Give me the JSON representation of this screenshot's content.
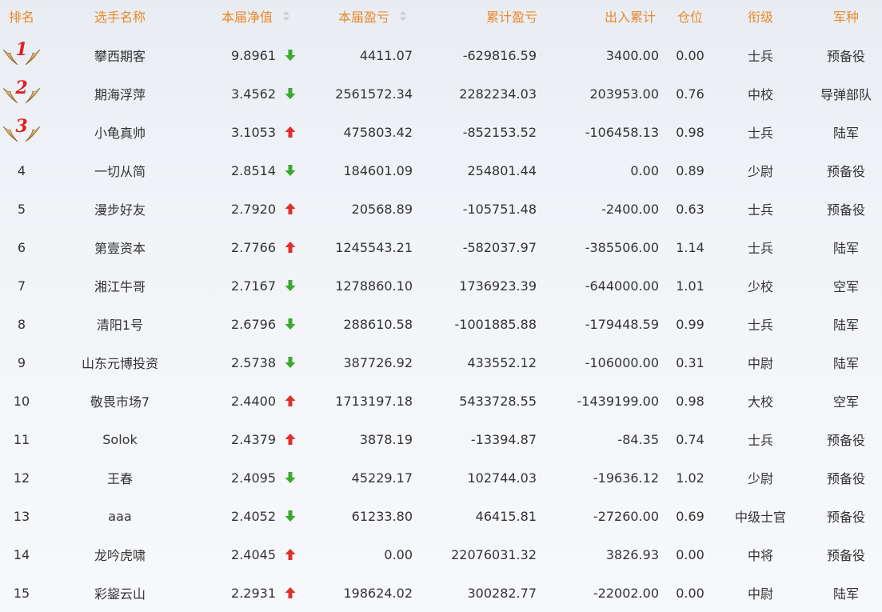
{
  "columns": [
    {
      "key": "rank",
      "label": "排名",
      "sortable": false
    },
    {
      "key": "name",
      "label": "选手名称",
      "sortable": false
    },
    {
      "key": "nav",
      "label": "本届净值",
      "sortable": true
    },
    {
      "key": "profit",
      "label": "本届盈亏",
      "sortable": true
    },
    {
      "key": "cum_profit",
      "label": "累计盈亏",
      "sortable": false
    },
    {
      "key": "inout",
      "label": "出入累计",
      "sortable": false
    },
    {
      "key": "position",
      "label": "仓位",
      "sortable": false
    },
    {
      "key": "grade",
      "label": "衔级",
      "sortable": false
    },
    {
      "key": "branch",
      "label": "军种",
      "sortable": false
    }
  ],
  "colors": {
    "header": "#e98a2c",
    "up": "#e0302c",
    "down": "#3aaa2e",
    "rank_badge": "#e02020"
  },
  "rows": [
    {
      "rank": "1",
      "badge": true,
      "name": "攀西期客",
      "nav": "9.8961",
      "trend": "down",
      "profit": "4411.07",
      "cum_profit": "-629816.59",
      "inout": "3400.00",
      "position": "0.00",
      "grade": "士兵",
      "branch": "预备役"
    },
    {
      "rank": "2",
      "badge": true,
      "name": "期海浮萍",
      "nav": "3.4562",
      "trend": "down",
      "profit": "2561572.34",
      "cum_profit": "2282234.03",
      "inout": "203953.00",
      "position": "0.76",
      "grade": "中校",
      "branch": "导弹部队"
    },
    {
      "rank": "3",
      "badge": true,
      "name": "小龟真帅",
      "nav": "3.1053",
      "trend": "up",
      "profit": "475803.42",
      "cum_profit": "-852153.52",
      "inout": "-106458.13",
      "position": "0.98",
      "grade": "士兵",
      "branch": "陆军"
    },
    {
      "rank": "4",
      "badge": false,
      "name": "一切从简",
      "nav": "2.8514",
      "trend": "down",
      "profit": "184601.09",
      "cum_profit": "254801.44",
      "inout": "0.00",
      "position": "0.89",
      "grade": "少尉",
      "branch": "预备役"
    },
    {
      "rank": "5",
      "badge": false,
      "name": "漫步好友",
      "nav": "2.7920",
      "trend": "up",
      "profit": "20568.89",
      "cum_profit": "-105751.48",
      "inout": "-2400.00",
      "position": "0.63",
      "grade": "士兵",
      "branch": "预备役"
    },
    {
      "rank": "6",
      "badge": false,
      "name": "第壹资本",
      "nav": "2.7766",
      "trend": "up",
      "profit": "1245543.21",
      "cum_profit": "-582037.97",
      "inout": "-385506.00",
      "position": "1.14",
      "grade": "士兵",
      "branch": "陆军"
    },
    {
      "rank": "7",
      "badge": false,
      "name": "湘江牛哥",
      "nav": "2.7167",
      "trend": "down",
      "profit": "1278860.10",
      "cum_profit": "1736923.39",
      "inout": "-644000.00",
      "position": "1.01",
      "grade": "少校",
      "branch": "空军"
    },
    {
      "rank": "8",
      "badge": false,
      "name": "清阳1号",
      "nav": "2.6796",
      "trend": "down",
      "profit": "288610.58",
      "cum_profit": "-1001885.88",
      "inout": "-179448.59",
      "position": "0.99",
      "grade": "士兵",
      "branch": "陆军"
    },
    {
      "rank": "9",
      "badge": false,
      "name": "山东元博投资",
      "nav": "2.5738",
      "trend": "down",
      "profit": "387726.92",
      "cum_profit": "433552.12",
      "inout": "-106000.00",
      "position": "0.31",
      "grade": "中尉",
      "branch": "陆军"
    },
    {
      "rank": "10",
      "badge": false,
      "name": "敬畏市场7",
      "nav": "2.4400",
      "trend": "up",
      "profit": "1713197.18",
      "cum_profit": "5433728.55",
      "inout": "-1439199.00",
      "position": "0.98",
      "grade": "大校",
      "branch": "空军"
    },
    {
      "rank": "11",
      "badge": false,
      "name": "Solok",
      "nav": "2.4379",
      "trend": "up",
      "profit": "3878.19",
      "cum_profit": "-13394.87",
      "inout": "-84.35",
      "position": "0.74",
      "grade": "士兵",
      "branch": "预备役"
    },
    {
      "rank": "12",
      "badge": false,
      "name": "王春",
      "nav": "2.4095",
      "trend": "down",
      "profit": "45229.17",
      "cum_profit": "102744.03",
      "inout": "-19636.12",
      "position": "1.02",
      "grade": "少尉",
      "branch": "预备役"
    },
    {
      "rank": "13",
      "badge": false,
      "name": "aaa",
      "nav": "2.4052",
      "trend": "down",
      "profit": "61233.80",
      "cum_profit": "46415.81",
      "inout": "-27260.00",
      "position": "0.69",
      "grade": "中级士官",
      "branch": "预备役"
    },
    {
      "rank": "14",
      "badge": false,
      "name": "龙吟虎啸",
      "nav": "2.4045",
      "trend": "up",
      "profit": "0.00",
      "cum_profit": "22076031.32",
      "inout": "3826.93",
      "position": "0.00",
      "grade": "中将",
      "branch": "预备役"
    },
    {
      "rank": "15",
      "badge": false,
      "name": "彩鋆云山",
      "nav": "2.2931",
      "trend": "up",
      "profit": "198624.02",
      "cum_profit": "300282.77",
      "inout": "-22002.00",
      "position": "0.00",
      "grade": "中尉",
      "branch": "陆军"
    }
  ]
}
